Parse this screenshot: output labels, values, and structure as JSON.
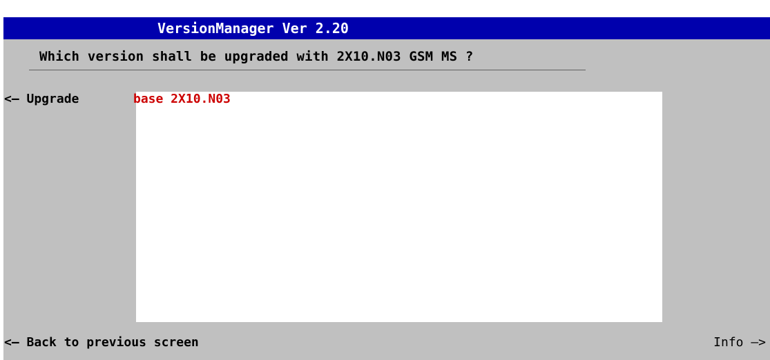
{
  "window": {
    "title": "VersionManager Ver 2.20"
  },
  "prompt": {
    "question": "Which version shall be upgraded with 2X10.N03 GSM MS ?"
  },
  "softkeys": {
    "upgrade_label": "<— Upgrade",
    "back_label": "<— Back to previous screen",
    "info_label": "Info —>"
  },
  "version_list": {
    "items": [
      {
        "label": "base 2X10.N03",
        "color": "#cc0000"
      }
    ]
  },
  "colors": {
    "titlebar": "#0000ad",
    "panel": "#c0c0c0",
    "list_background": "#ffffff",
    "selected_item": "#cc0000"
  }
}
